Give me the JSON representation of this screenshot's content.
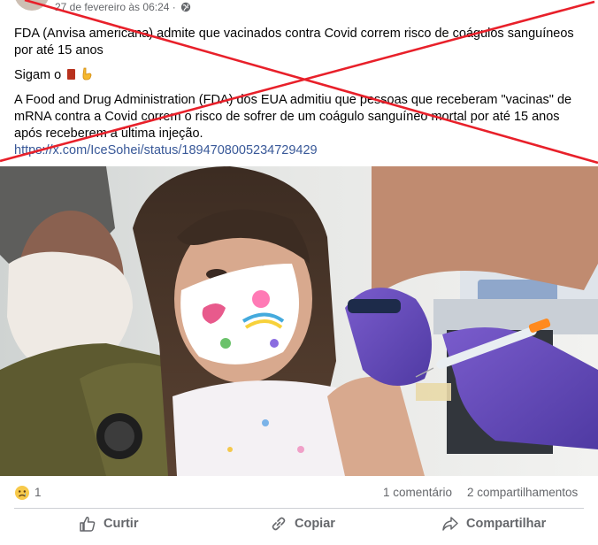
{
  "post": {
    "timestamp": "27 de fevereiro às 06:24 ·",
    "headline": "FDA (Anvisa americana) admite que vacinados contra Covid correm risco de coágulos sanguíneos por até 15 anos",
    "follow_text": "Sigam o",
    "body": "A Food and Drug Administration (FDA) dos EUA admitiu que pessoas que receberam \"vacinas\" de mRNA contra a Covid correm o risco de sofrer de um coágulo sanguíneo mortal por até 15 anos após receberem a última injeção.",
    "link": "https://x.com/IceSohei/status/1894708005234729429"
  },
  "stats": {
    "reaction_count": "1",
    "comments": "1 comentário",
    "shares": "2 compartilhamentos"
  },
  "actions": {
    "like": "Curtir",
    "copy": "Copiar",
    "share": "Compartilhar"
  },
  "icons": [
    "globe-icon",
    "book-emoji-icon",
    "pointing-down-emoji-icon",
    "sad-reaction-icon",
    "like-icon",
    "link-icon",
    "share-icon"
  ],
  "colors": {
    "cross": "#e8202a",
    "link": "#385898",
    "muted": "#65676b"
  }
}
